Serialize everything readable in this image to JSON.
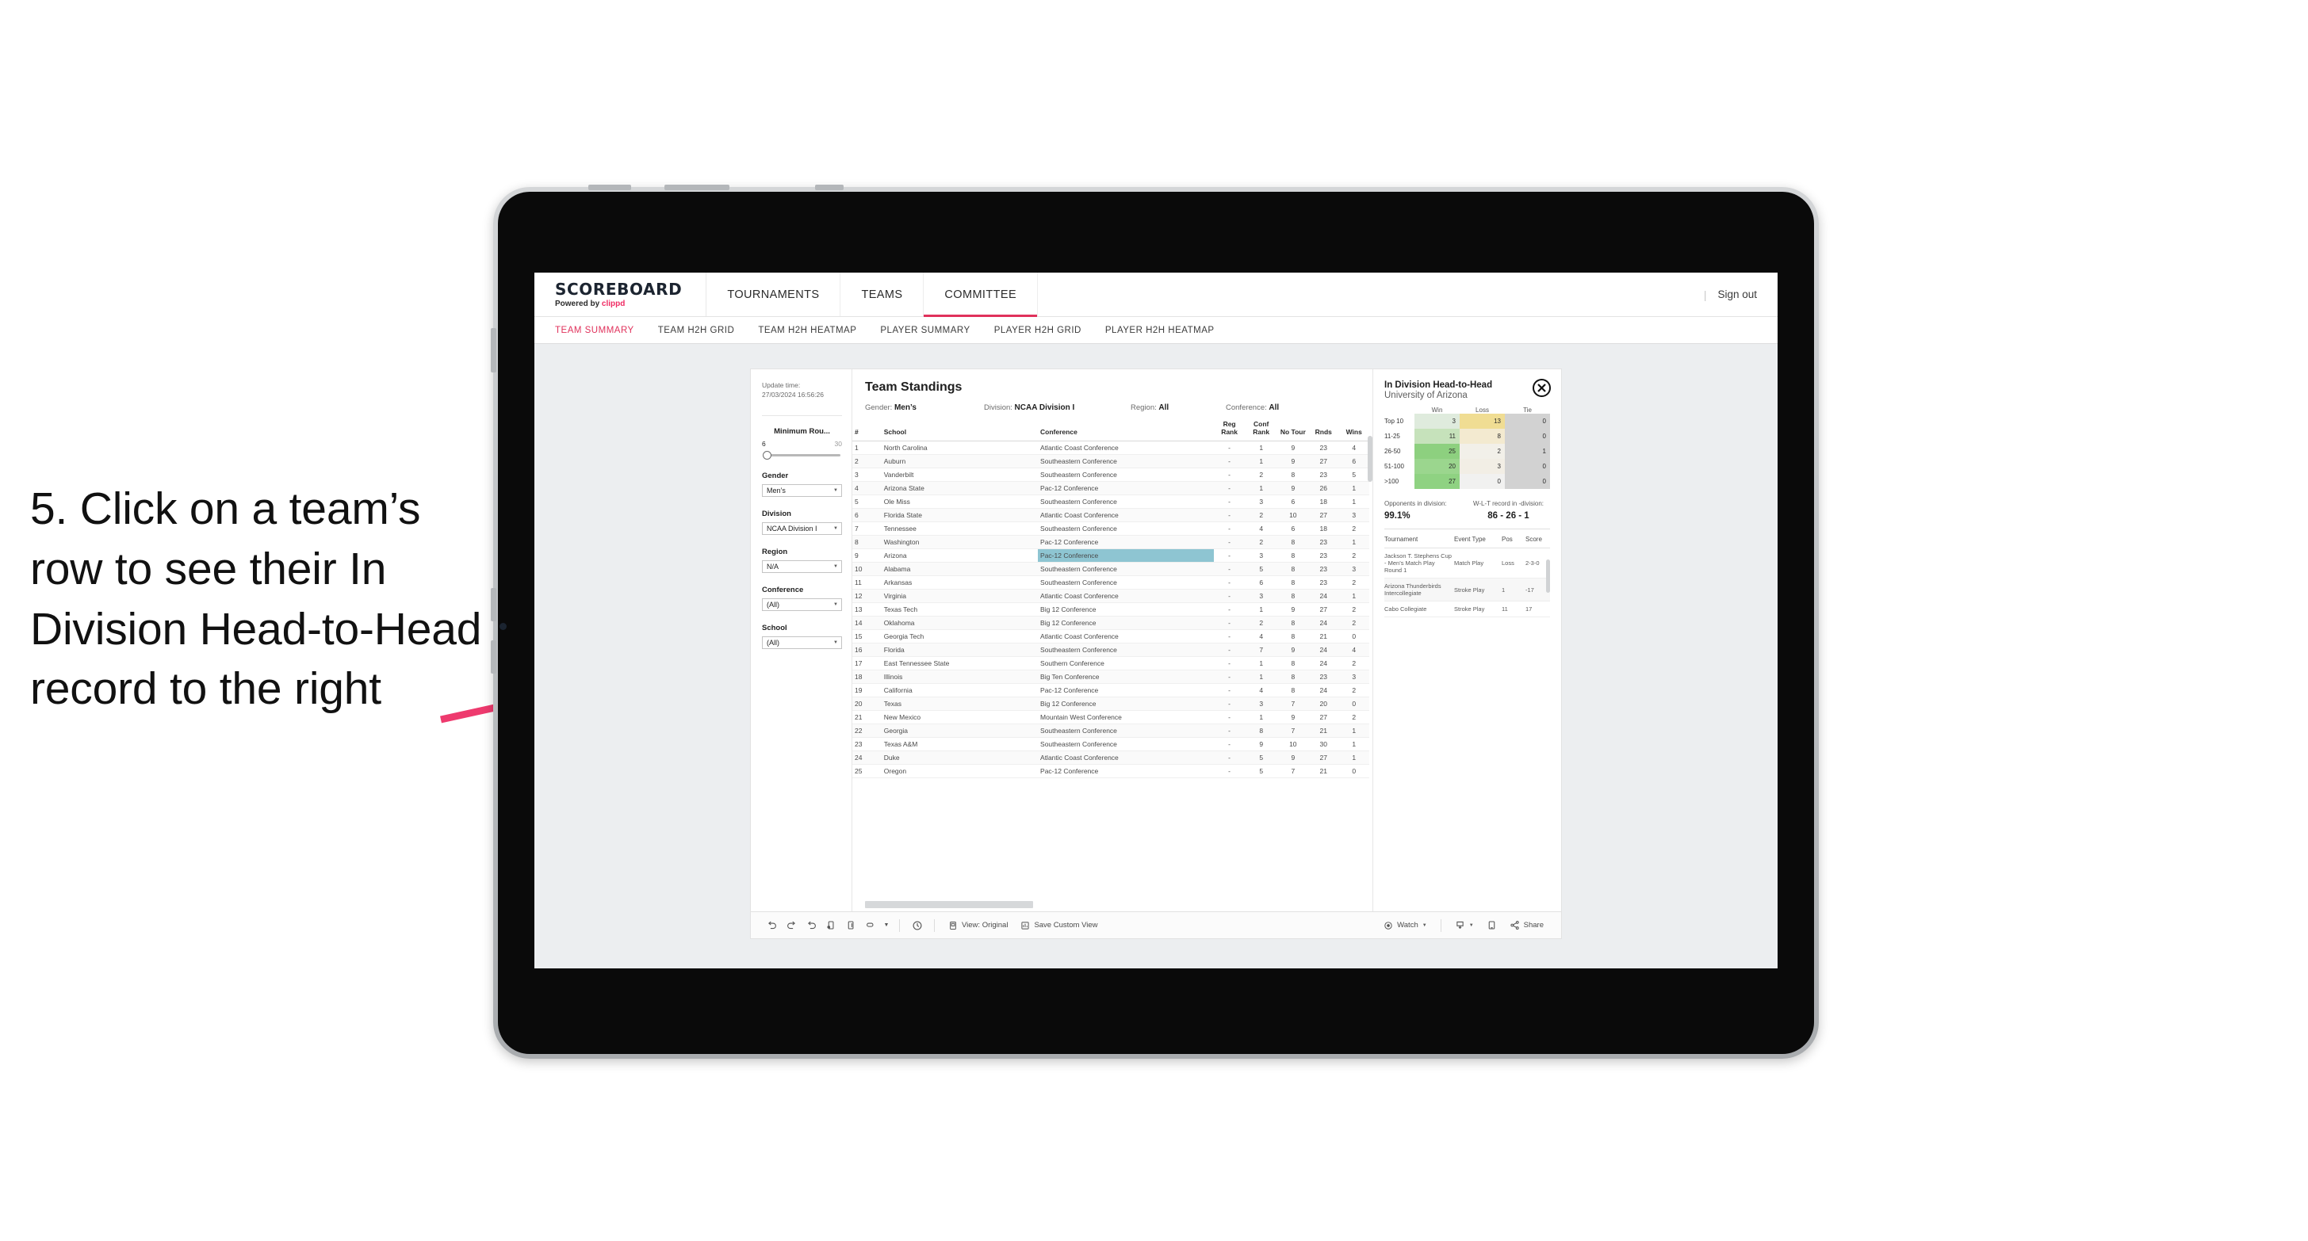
{
  "annotation": {
    "text": "5. Click on a team’s row to see their In Division Head-to-Head record to the right",
    "arrow_color": "#ee3a6e"
  },
  "app": {
    "brand": {
      "title": "SCOREBOARD",
      "powered_prefix": "Powered by ",
      "powered_brand": "clippd"
    },
    "nav": [
      {
        "label": "TOURNAMENTS",
        "active": false
      },
      {
        "label": "TEAMS",
        "active": false
      },
      {
        "label": "COMMITTEE",
        "active": true
      }
    ],
    "nav_right": {
      "separator": "|",
      "sign_out": "Sign out"
    },
    "subnav": [
      {
        "label": "TEAM SUMMARY",
        "active": true
      },
      {
        "label": "TEAM H2H GRID",
        "active": false
      },
      {
        "label": "TEAM H2H HEATMAP",
        "active": false
      },
      {
        "label": "PLAYER SUMMARY",
        "active": false
      },
      {
        "label": "PLAYER H2H GRID",
        "active": false
      },
      {
        "label": "PLAYER H2H HEATMAP",
        "active": false
      }
    ]
  },
  "filters": {
    "update_time_label": "Update time:",
    "update_time_value": "27/03/2024 16:56:26",
    "min_rounds": {
      "label": "Minimum Rou...",
      "min": "6",
      "max": "30"
    },
    "gender": {
      "label": "Gender",
      "value": "Men’s"
    },
    "division": {
      "label": "Division",
      "value": "NCAA Division I"
    },
    "region": {
      "label": "Region",
      "value": "N/A"
    },
    "conference": {
      "label": "Conference",
      "value": "(All)"
    },
    "school": {
      "label": "School",
      "value": "(All)"
    }
  },
  "standings": {
    "title": "Team Standings",
    "meta": {
      "gender_label": "Gender:",
      "gender_value": "Men’s",
      "division_label": "Division:",
      "division_value": "NCAA Division I",
      "region_label": "Region:",
      "region_value": "All",
      "conference_label": "Conference:",
      "conference_value": "All"
    },
    "columns": [
      "#",
      "School",
      "Conference",
      "Reg Rank",
      "Conf Rank",
      "No Tour",
      "Rnds",
      "Wins"
    ],
    "rows": [
      {
        "rank": "1",
        "school": "North Carolina",
        "conf": "Atlantic Coast Conference",
        "reg": "-",
        "confrank": "1",
        "notour": "9",
        "rnds": "23",
        "wins": "4"
      },
      {
        "rank": "2",
        "school": "Auburn",
        "conf": "Southeastern Conference",
        "reg": "-",
        "confrank": "1",
        "notour": "9",
        "rnds": "27",
        "wins": "6"
      },
      {
        "rank": "3",
        "school": "Vanderbilt",
        "conf": "Southeastern Conference",
        "reg": "-",
        "confrank": "2",
        "notour": "8",
        "rnds": "23",
        "wins": "5"
      },
      {
        "rank": "4",
        "school": "Arizona State",
        "conf": "Pac-12 Conference",
        "reg": "-",
        "confrank": "1",
        "notour": "9",
        "rnds": "26",
        "wins": "1"
      },
      {
        "rank": "5",
        "school": "Ole Miss",
        "conf": "Southeastern Conference",
        "reg": "-",
        "confrank": "3",
        "notour": "6",
        "rnds": "18",
        "wins": "1"
      },
      {
        "rank": "6",
        "school": "Florida State",
        "conf": "Atlantic Coast Conference",
        "reg": "-",
        "confrank": "2",
        "notour": "10",
        "rnds": "27",
        "wins": "3"
      },
      {
        "rank": "7",
        "school": "Tennessee",
        "conf": "Southeastern Conference",
        "reg": "-",
        "confrank": "4",
        "notour": "6",
        "rnds": "18",
        "wins": "2"
      },
      {
        "rank": "8",
        "school": "Washington",
        "conf": "Pac-12 Conference",
        "reg": "-",
        "confrank": "2",
        "notour": "8",
        "rnds": "23",
        "wins": "1"
      },
      {
        "rank": "9",
        "school": "Arizona",
        "conf": "Pac-12 Conference",
        "reg": "-",
        "confrank": "3",
        "notour": "8",
        "rnds": "23",
        "wins": "2",
        "selected": true
      },
      {
        "rank": "10",
        "school": "Alabama",
        "conf": "Southeastern Conference",
        "reg": "-",
        "confrank": "5",
        "notour": "8",
        "rnds": "23",
        "wins": "3"
      },
      {
        "rank": "11",
        "school": "Arkansas",
        "conf": "Southeastern Conference",
        "reg": "-",
        "confrank": "6",
        "notour": "8",
        "rnds": "23",
        "wins": "2"
      },
      {
        "rank": "12",
        "school": "Virginia",
        "conf": "Atlantic Coast Conference",
        "reg": "-",
        "confrank": "3",
        "notour": "8",
        "rnds": "24",
        "wins": "1"
      },
      {
        "rank": "13",
        "school": "Texas Tech",
        "conf": "Big 12 Conference",
        "reg": "-",
        "confrank": "1",
        "notour": "9",
        "rnds": "27",
        "wins": "2"
      },
      {
        "rank": "14",
        "school": "Oklahoma",
        "conf": "Big 12 Conference",
        "reg": "-",
        "confrank": "2",
        "notour": "8",
        "rnds": "24",
        "wins": "2"
      },
      {
        "rank": "15",
        "school": "Georgia Tech",
        "conf": "Atlantic Coast Conference",
        "reg": "-",
        "confrank": "4",
        "notour": "8",
        "rnds": "21",
        "wins": "0"
      },
      {
        "rank": "16",
        "school": "Florida",
        "conf": "Southeastern Conference",
        "reg": "-",
        "confrank": "7",
        "notour": "9",
        "rnds": "24",
        "wins": "4"
      },
      {
        "rank": "17",
        "school": "East Tennessee State",
        "conf": "Southern Conference",
        "reg": "-",
        "confrank": "1",
        "notour": "8",
        "rnds": "24",
        "wins": "2"
      },
      {
        "rank": "18",
        "school": "Illinois",
        "conf": "Big Ten Conference",
        "reg": "-",
        "confrank": "1",
        "notour": "8",
        "rnds": "23",
        "wins": "3"
      },
      {
        "rank": "19",
        "school": "California",
        "conf": "Pac-12 Conference",
        "reg": "-",
        "confrank": "4",
        "notour": "8",
        "rnds": "24",
        "wins": "2"
      },
      {
        "rank": "20",
        "school": "Texas",
        "conf": "Big 12 Conference",
        "reg": "-",
        "confrank": "3",
        "notour": "7",
        "rnds": "20",
        "wins": "0"
      },
      {
        "rank": "21",
        "school": "New Mexico",
        "conf": "Mountain West Conference",
        "reg": "-",
        "confrank": "1",
        "notour": "9",
        "rnds": "27",
        "wins": "2"
      },
      {
        "rank": "22",
        "school": "Georgia",
        "conf": "Southeastern Conference",
        "reg": "-",
        "confrank": "8",
        "notour": "7",
        "rnds": "21",
        "wins": "1"
      },
      {
        "rank": "23",
        "school": "Texas A&M",
        "conf": "Southeastern Conference",
        "reg": "-",
        "confrank": "9",
        "notour": "10",
        "rnds": "30",
        "wins": "1"
      },
      {
        "rank": "24",
        "school": "Duke",
        "conf": "Atlantic Coast Conference",
        "reg": "-",
        "confrank": "5",
        "notour": "9",
        "rnds": "27",
        "wins": "1"
      },
      {
        "rank": "25",
        "school": "Oregon",
        "conf": "Pac-12 Conference",
        "reg": "-",
        "confrank": "5",
        "notour": "7",
        "rnds": "21",
        "wins": "0"
      }
    ]
  },
  "h2h": {
    "title": "In Division Head-to-Head",
    "subtitle": "University of Arizona",
    "close_label": "×",
    "chart_data": {
      "type": "heatmap",
      "title": "In Division Head-to-Head",
      "columns": [
        "Win",
        "Loss",
        "Tie"
      ],
      "rows": [
        "Top 10",
        "11-25",
        "26-50",
        "51-100",
        ">100"
      ],
      "values": [
        [
          3,
          13,
          0
        ],
        [
          11,
          8,
          0
        ],
        [
          25,
          2,
          1
        ],
        [
          20,
          3,
          0
        ],
        [
          27,
          0,
          0
        ]
      ],
      "cell_colors": [
        [
          "#dfebdd",
          "#f0dd93",
          "#d2d2d2"
        ],
        [
          "#c6e2bb",
          "#f3ead0",
          "#d2d2d2"
        ],
        [
          "#8dd07f",
          "#f2f0e9",
          "#d2d2d2"
        ],
        [
          "#9bd68e",
          "#f2eee5",
          "#d2d2d2"
        ],
        [
          "#8fd282",
          "#f1f1f0",
          "#d2d2d2"
        ]
      ]
    },
    "kpi_opponents_label": "Opponents in division:",
    "kpi_opponents_value": "99.1%",
    "kpi_record_label": "W-L-T record in -division:",
    "kpi_record_value": "86 - 26 - 1",
    "tour_columns": [
      "Tournament",
      "Event Type",
      "Pos",
      "Score"
    ],
    "tour_rows": [
      {
        "tournament": "Jackson T. Stephens Cup - Men’s Match Play Round 1",
        "event_type": "Match Play",
        "pos": "Loss",
        "score": "2-3-0"
      },
      {
        "tournament": "Arizona Thunderbirds Intercollegiate",
        "event_type": "Stroke Play",
        "pos": "1",
        "score": "-17"
      },
      {
        "tournament": "Cabo Collegiate",
        "event_type": "Stroke Play",
        "pos": "11",
        "score": "17"
      }
    ]
  },
  "toolbar": {
    "view_label": "View: Original",
    "save_label": "Save Custom View",
    "watch_label": "Watch",
    "share_label": "Share"
  }
}
